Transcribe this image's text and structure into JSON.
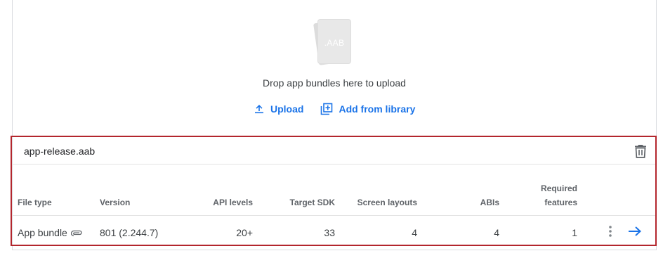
{
  "upload_area": {
    "file_icon_ext": ".AAB",
    "drop_text": "Drop app bundles here to upload",
    "upload_label": "Upload",
    "add_from_library_label": "Add from library"
  },
  "bundle": {
    "file_name": "app-release.aab",
    "columns": {
      "file_type": "File type",
      "version": "Version",
      "api_levels": "API levels",
      "target_sdk": "Target SDK",
      "screen_layouts": "Screen layouts",
      "abis": "ABIs",
      "required_features_line1": "Required",
      "required_features_line2": "features"
    },
    "row": {
      "file_type": "App bundle",
      "version": "801 (2.244.7)",
      "api_levels": "20+",
      "target_sdk": "33",
      "screen_layouts": "4",
      "abis": "4",
      "required_features": "1"
    }
  },
  "icons": {
    "upload": "upload-icon",
    "library": "add-library-icon",
    "trash": "trash-icon",
    "attachment": "paperclip-icon",
    "more": "more-vertical-icon",
    "open": "arrow-right-icon"
  },
  "colors": {
    "accent": "#1a73e8",
    "highlight_border": "#b3262d"
  }
}
